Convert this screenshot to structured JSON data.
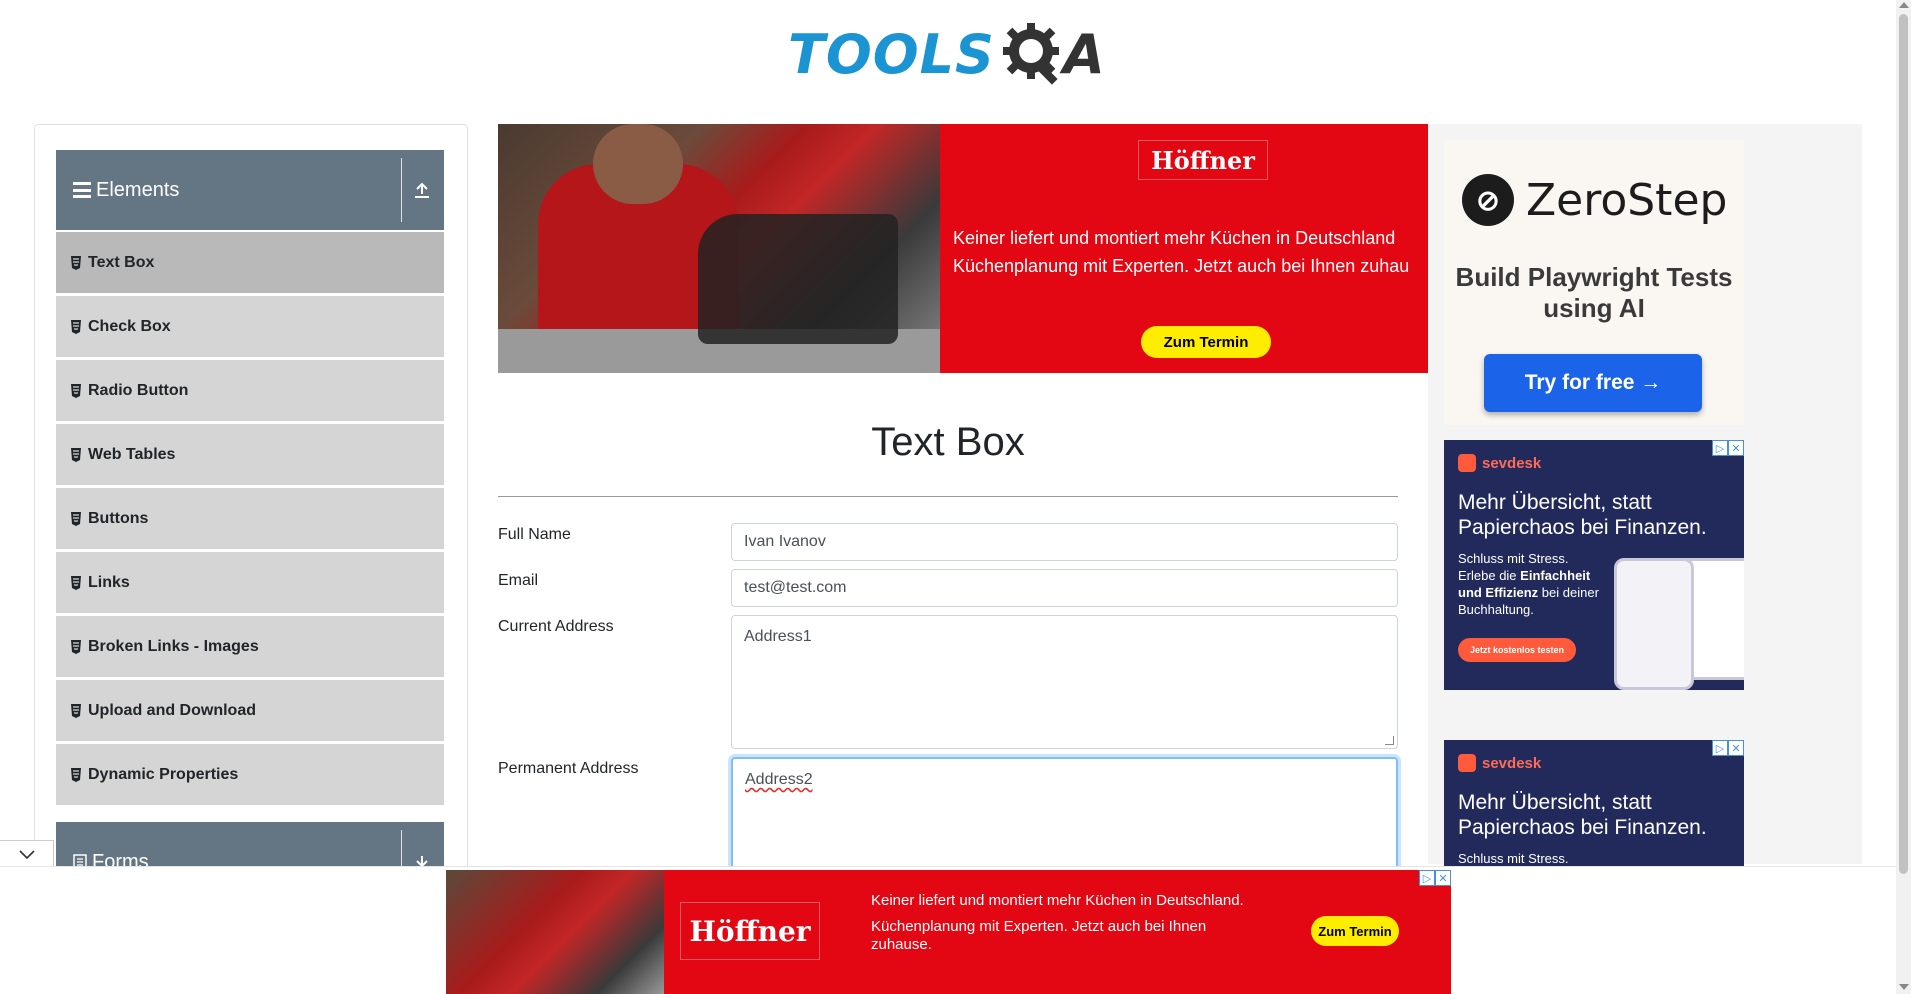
{
  "logo": {
    "left": "TOOLS",
    "right": "A"
  },
  "sidebar": {
    "groups": [
      {
        "label": "Elements",
        "icon": "upload-icon"
      },
      {
        "label": "Forms",
        "icon": "download-icon"
      }
    ],
    "items": [
      {
        "label": "Text Box",
        "active": true
      },
      {
        "label": "Check Box"
      },
      {
        "label": "Radio Button"
      },
      {
        "label": "Web Tables"
      },
      {
        "label": "Buttons"
      },
      {
        "label": "Links"
      },
      {
        "label": "Broken Links - Images"
      },
      {
        "label": "Upload and Download"
      },
      {
        "label": "Dynamic Properties"
      }
    ]
  },
  "top_ad": {
    "brand": "Höffner",
    "line1": "Keiner liefert und montiert mehr Küchen in Deutschland",
    "line2": "Küchenplanung mit Experten. Jetzt auch bei Ihnen zuhau",
    "cta": "Zum Termin"
  },
  "main": {
    "title": "Text Box",
    "fields": {
      "full_name": {
        "label": "Full Name",
        "value": "Ivan Ivanov"
      },
      "email": {
        "label": "Email",
        "value": "test@test.com"
      },
      "current_address": {
        "label": "Current Address",
        "value": "Address1"
      },
      "permanent_address": {
        "label": "Permanent Address",
        "value": "Address2"
      }
    }
  },
  "zerostep_ad": {
    "name": "ZeroStep",
    "tagline": "Build Playwright Tests using AI",
    "cta": "Try for free →"
  },
  "sevdesk_ad": {
    "brand": "sevdesk",
    "headline": "Mehr Übersicht, statt Papierchaos bei Finanzen.",
    "body_1": "Schluss mit Stress.",
    "body_2": "Erlebe die",
    "body_bold": "Einfachheit und Effizienz",
    "body_3": "bei deiner Buchhaltung.",
    "cta": "Jetzt kostenlos testen"
  },
  "bottom_ad": {
    "brand": "Höffner",
    "line1": "Keiner liefert und montiert mehr Küchen in Deutschland.",
    "line2": "Küchenplanung mit Experten. Jetzt auch bei Ihnen zuhause.",
    "cta": "Zum Termin"
  },
  "colors": {
    "brand_blue": "#1a94d2",
    "sidebar_header": "#647583",
    "menu_item": "#d5d5d5",
    "ad_red": "#e30613",
    "cta_yellow": "#ffed00",
    "zerostep_blue": "#1b63e8",
    "sevdesk_navy": "#222a5c"
  }
}
